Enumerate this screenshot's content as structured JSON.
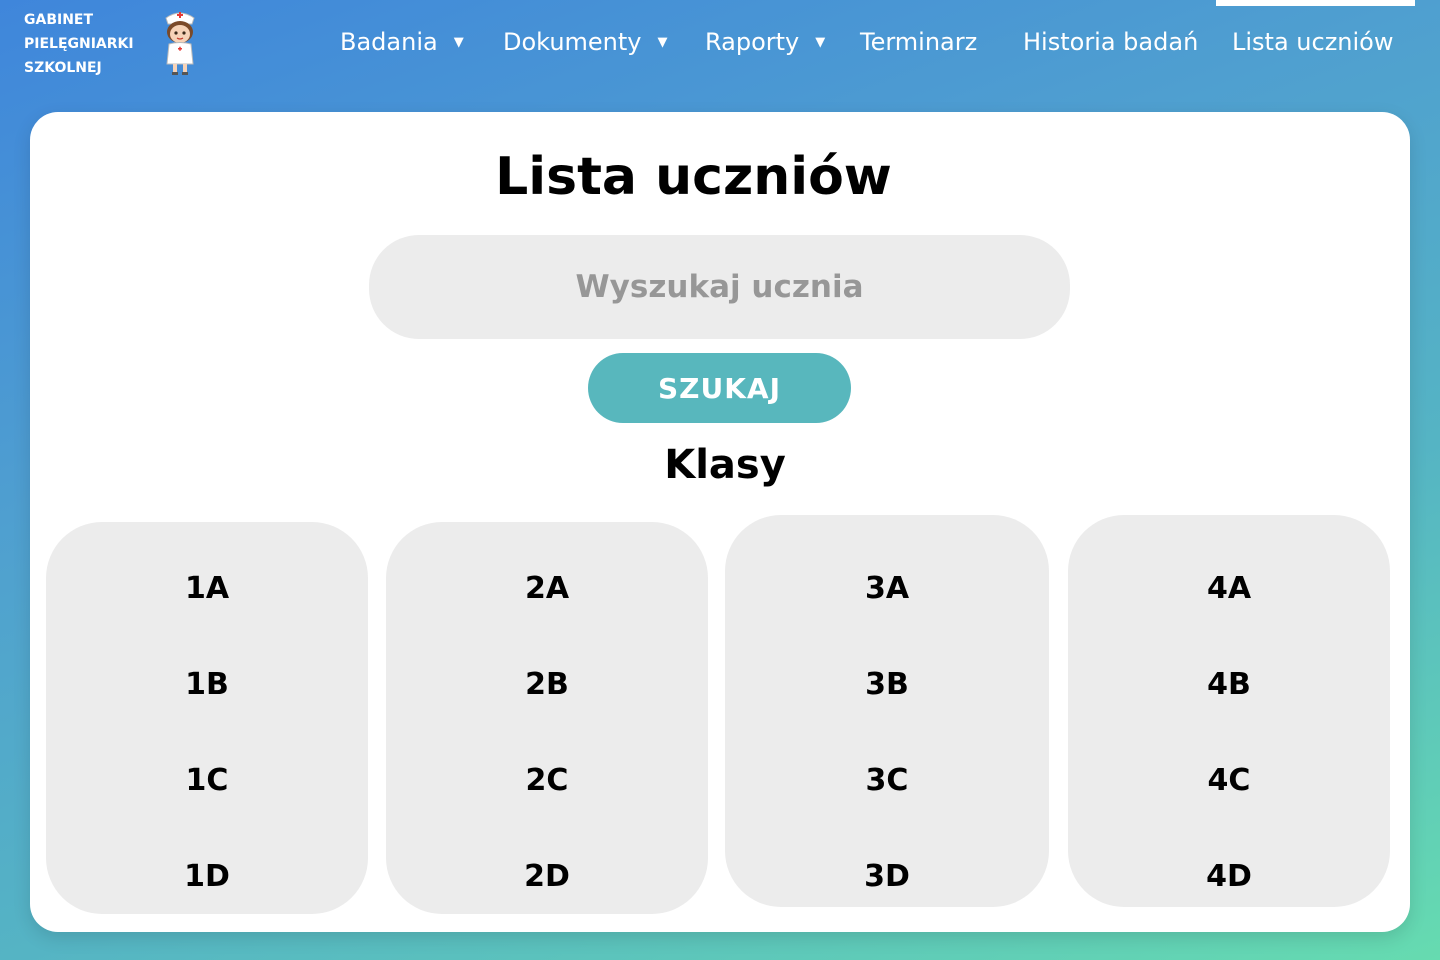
{
  "brand": {
    "line1": "GABINET",
    "line2": "PIELĘGNIARKI",
    "line3": "SZKOLNEJ",
    "logo_icon": "nurse-icon"
  },
  "nav": {
    "items": [
      {
        "label": "Badania",
        "has_dropdown": true
      },
      {
        "label": "Dokumenty",
        "has_dropdown": true
      },
      {
        "label": "Raporty",
        "has_dropdown": true
      },
      {
        "label": "Terminarz",
        "has_dropdown": false
      },
      {
        "label": "Historia badań",
        "has_dropdown": false
      },
      {
        "label": "Lista uczniów",
        "has_dropdown": false,
        "active": true
      }
    ],
    "caret": "▼"
  },
  "main": {
    "title": "Lista uczniów",
    "search_placeholder": "Wyszukaj ucznia",
    "search_button": "SZUKAJ",
    "classes_title": "Klasy",
    "columns": [
      [
        "1A",
        "1B",
        "1C",
        "1D"
      ],
      [
        "2A",
        "2B",
        "2C",
        "2D"
      ],
      [
        "3A",
        "3B",
        "3C",
        "3D"
      ],
      [
        "4A",
        "4B",
        "4C",
        "4D"
      ]
    ]
  },
  "colors": {
    "accent": "#58b7bd",
    "panel": "#ececec",
    "gradient_start": "#3f86db",
    "gradient_end": "#66dbb0"
  }
}
